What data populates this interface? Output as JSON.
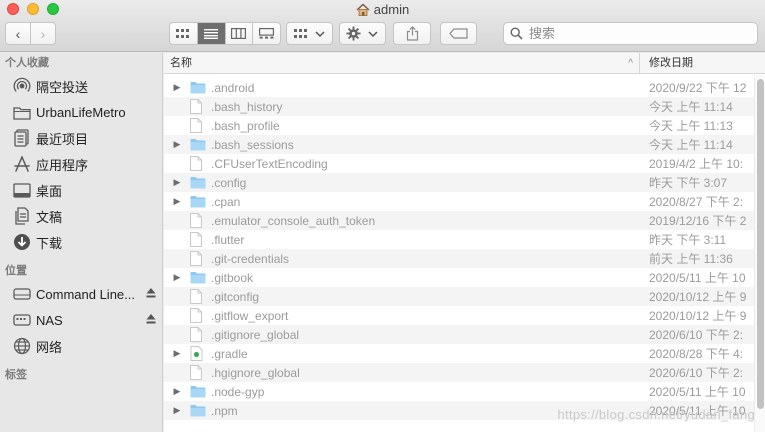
{
  "window": {
    "title": "admin"
  },
  "toolbar": {
    "back": "‹",
    "forward": "›",
    "search_placeholder": "搜索"
  },
  "sidebar": {
    "sections": [
      {
        "title": "个人收藏",
        "items": [
          {
            "label": "隔空投送",
            "icon": "airdrop-icon"
          },
          {
            "label": "UrbanLifeMetro",
            "icon": "folder-icon"
          },
          {
            "label": "最近项目",
            "icon": "recents-icon"
          },
          {
            "label": "应用程序",
            "icon": "applications-icon"
          },
          {
            "label": "桌面",
            "icon": "desktop-icon"
          },
          {
            "label": "文稿",
            "icon": "documents-icon"
          },
          {
            "label": "下载",
            "icon": "downloads-icon"
          }
        ]
      },
      {
        "title": "位置",
        "items": [
          {
            "label": "Command Line...",
            "icon": "disk-icon",
            "eject": true
          },
          {
            "label": "NAS",
            "icon": "nas-icon",
            "eject": true
          },
          {
            "label": "网络",
            "icon": "network-icon"
          }
        ]
      },
      {
        "title": "标签",
        "items": []
      }
    ]
  },
  "columns": {
    "name": "名称",
    "date": "修改日期",
    "sort_indicator": "^"
  },
  "files": [
    {
      "name": ".android",
      "date": "2020/9/22 下午 12",
      "type": "folder"
    },
    {
      "name": ".bash_history",
      "date": "今天 上午 11:14",
      "type": "file"
    },
    {
      "name": ".bash_profile",
      "date": "今天 上午 11:13",
      "type": "file"
    },
    {
      "name": ".bash_sessions",
      "date": "今天 上午 11:14",
      "type": "folder"
    },
    {
      "name": ".CFUserTextEncoding",
      "date": "2019/4/2 上午 10:",
      "type": "file"
    },
    {
      "name": ".config",
      "date": "昨天 下午 3:07",
      "type": "folder"
    },
    {
      "name": ".cpan",
      "date": "2020/8/27 下午 2:",
      "type": "folder"
    },
    {
      "name": ".emulator_console_auth_token",
      "date": "2019/12/16 下午 2",
      "type": "file"
    },
    {
      "name": ".flutter",
      "date": "昨天 下午 3:11",
      "type": "file"
    },
    {
      "name": ".git-credentials",
      "date": "前天 上午 11:36",
      "type": "file"
    },
    {
      "name": ".gitbook",
      "date": "2020/5/11 上午 10",
      "type": "folder"
    },
    {
      "name": ".gitconfig",
      "date": "2020/10/12 上午 9",
      "type": "file"
    },
    {
      "name": ".gitflow_export",
      "date": "2020/10/12 上午 9",
      "type": "file"
    },
    {
      "name": ".gitignore_global",
      "date": "2020/6/10 下午 2:",
      "type": "file"
    },
    {
      "name": ".gradle",
      "date": "2020/8/28 下午 4:",
      "type": "gradle"
    },
    {
      "name": ".hgignore_global",
      "date": "2020/6/10 下午 2:",
      "type": "file"
    },
    {
      "name": ".node-gyp",
      "date": "2020/5/11 上午 10",
      "type": "folder"
    },
    {
      "name": ".npm",
      "date": "2020/5/11 上午 10",
      "type": "folder"
    }
  ],
  "watermark": "https://blog.csdn.net/yudan_fang",
  "colors": {
    "folder": "#8cc8ef",
    "accent": "#6e6e6e"
  }
}
